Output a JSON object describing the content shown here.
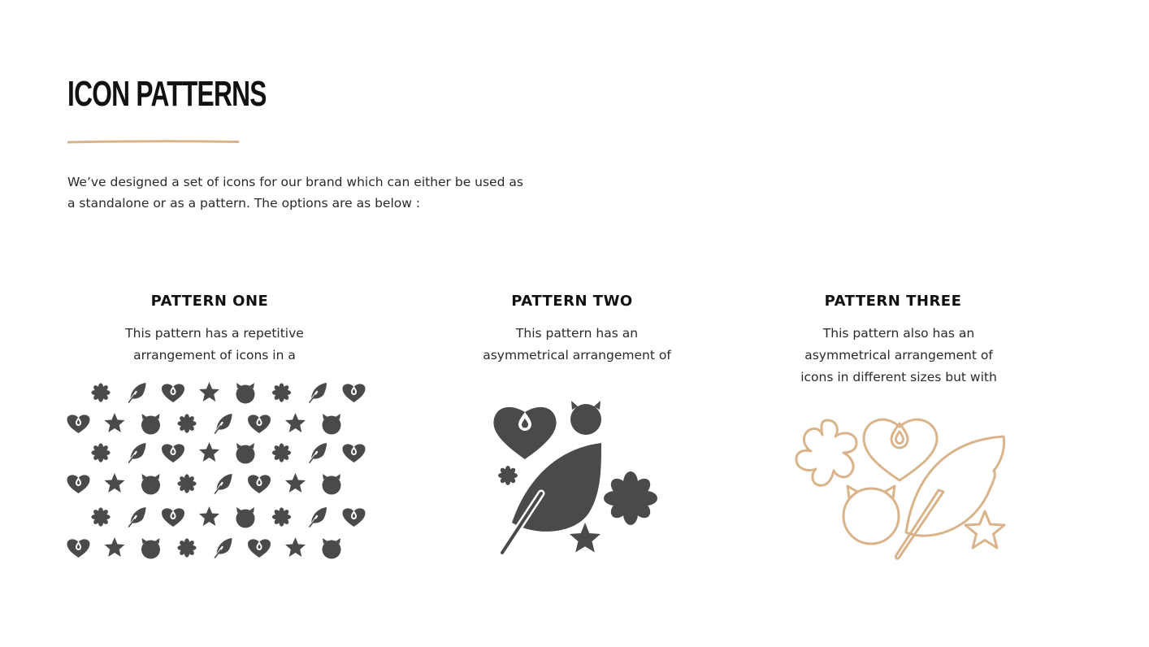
{
  "page": {
    "title": "ICON PATTERNS",
    "intro": "We’ve designed a set of icons for our brand which can either be used as a standalone or as a pattern. The options are as below :"
  },
  "patterns": [
    {
      "title": "PATTERN ONE",
      "description": "This pattern has a repetitive arrangement of icons in a",
      "icon_color": "#4a4a4a"
    },
    {
      "title": "PATTERN TWO",
      "description": "This pattern has an asymmetrical arrangement of",
      "icon_color": "#4a4a4a"
    },
    {
      "title": "PATTERN THREE",
      "description": "This pattern also has an asymmetrical arrangement of icons in different sizes but with",
      "icon_color": "#d9b48b"
    }
  ],
  "colors": {
    "accent": "#d9b48b",
    "icon_dark": "#4a4a4a",
    "text": "#2a2a2a"
  },
  "icons": [
    "flower-icon",
    "feather-icon",
    "heart-drop-icon",
    "star-icon",
    "devil-circle-icon"
  ]
}
